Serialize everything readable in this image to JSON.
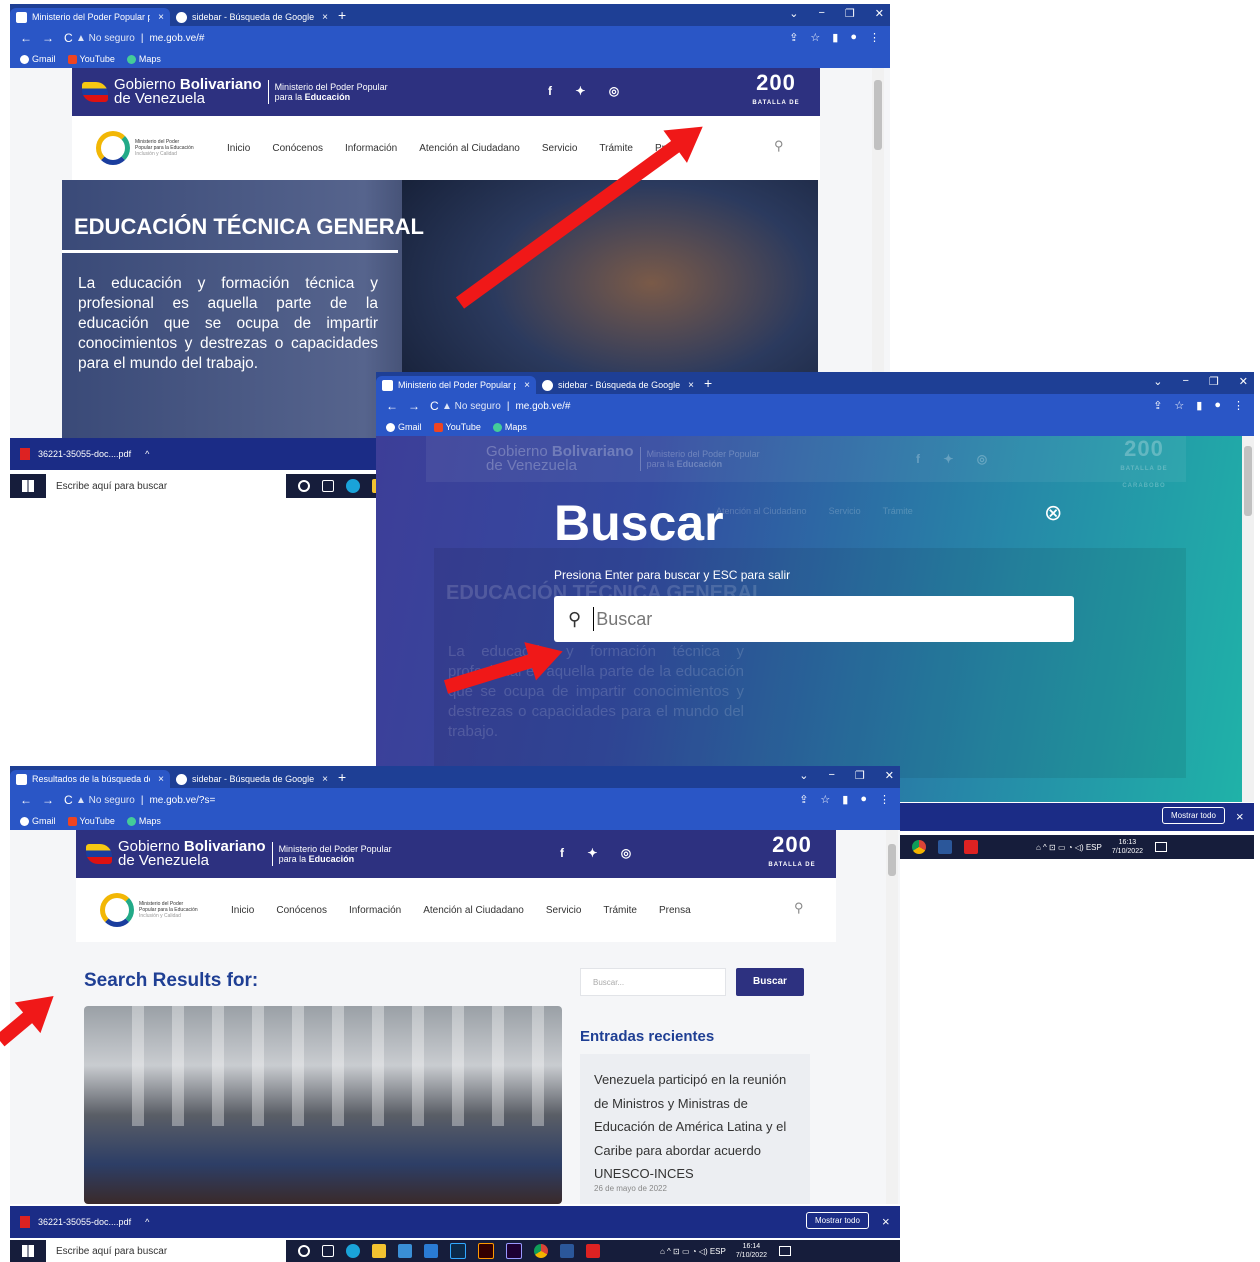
{
  "browser": {
    "tab1": "Ministerio del Poder Popular para",
    "tab1_results": "Resultados de la búsqueda de",
    "tab2": "sidebar - Búsqueda de Google",
    "tab_close": "×",
    "new_tab": "+",
    "window_controls": [
      "⌄",
      "−",
      "❐",
      "✕"
    ],
    "nav_buttons": [
      "←",
      "→",
      "C"
    ],
    "insecure": "▲ No seguro",
    "url1": "me.gob.ve/#",
    "url3": "me.gob.ve/?s=",
    "tools": [
      "⇪",
      "☆",
      "▮",
      "●",
      "⋮"
    ],
    "bookmarks": [
      "Gmail",
      "YouTube",
      "Maps"
    ]
  },
  "site": {
    "gov_name_1": "Gobierno ",
    "gov_name_bold": "Bolivariano",
    "gov_name_2": "de Venezuela",
    "ministry_1": "Ministerio del Poder Popular",
    "ministry_2": "para la ",
    "ministry_bold": "Educación",
    "social": "f ✦ ◎",
    "bicentenary_num": "200",
    "bicentenary_sub": "BATALLA DE CARABOBO",
    "logo_text": "Ministerio del Poder Popular para la Educación",
    "logo_tag": "Inclusión y Calidad",
    "menu": [
      "Inicio",
      "Conócenos",
      "Información",
      "Atención al Ciudadano",
      "Servicio",
      "Trámite",
      "Prensa"
    ],
    "search_icon": "⚲"
  },
  "hero": {
    "title": "EDUCACIÓN TÉCNICA GENERAL",
    "body": "La educación y formación técnica y profesional es aquella parte de la educación que se ocupa de impartir conocimientos y destrezas o capacidades para el mundo del trabajo."
  },
  "overlay": {
    "title": "Buscar",
    "hint": "Presiona Enter para buscar y ESC para salir",
    "placeholder": "Buscar",
    "close": "⊗"
  },
  "results": {
    "title": "Search Results for:",
    "sidebar_placeholder": "Buscar...",
    "sidebar_button": "Buscar",
    "recent_title": "Entradas recientes",
    "recent_post": "Venezuela participó en la reunión de Ministros y Ministras de Educación de América Latina y el Caribe para abordar acuerdo UNESCO-INCES",
    "recent_date": "26 de mayo de 2022"
  },
  "downloads": {
    "file": "36221-35055-doc....pdf",
    "chevron": "^",
    "show_all": "Mostrar todo",
    "close": "×"
  },
  "taskbar": {
    "search": "Escribe aquí para buscar",
    "tray": "⌂ ^ ⊡ ▭ ◔ ◁) ESP",
    "time1": "16:13",
    "date1": "7/10/2022",
    "time2": "16:14",
    "date2": "7/10/2022"
  },
  "colors": {
    "browser_bar": "#2a56c6",
    "gov_band": "#2d3180",
    "overlay_left": "#3b3f9a",
    "overlay_right": "#1fb4a8",
    "title_blue": "#1f3f94",
    "arrow": "#f01818"
  }
}
